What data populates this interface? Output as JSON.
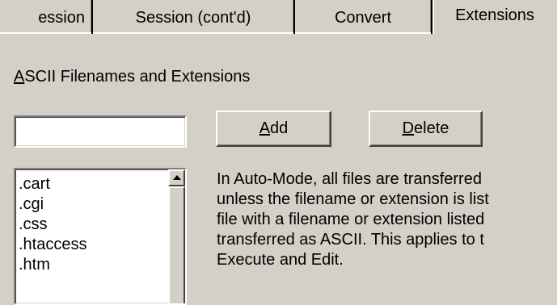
{
  "tabs": [
    {
      "label": "ession",
      "active": false
    },
    {
      "label": "Session (cont'd)",
      "active": false
    },
    {
      "label": "Convert",
      "active": false
    },
    {
      "label": "Extensions",
      "active": true
    }
  ],
  "section": {
    "label_mnemonic": "A",
    "label_rest": "SCII Filenames and Extensions"
  },
  "input": {
    "value": "",
    "placeholder": ""
  },
  "buttons": {
    "add_mnemonic": "A",
    "add_rest": "dd",
    "delete_mnemonic": "D",
    "delete_rest": "elete"
  },
  "extensions": [
    ".cart",
    ".cgi",
    ".css",
    ".htaccess",
    ".htm"
  ],
  "description_lines": [
    "In Auto-Mode, all files are transferred",
    "unless the filename or extension is list",
    "file with a filename or extension listed",
    "transferred as ASCII.  This applies to t",
    "Execute and Edit."
  ]
}
